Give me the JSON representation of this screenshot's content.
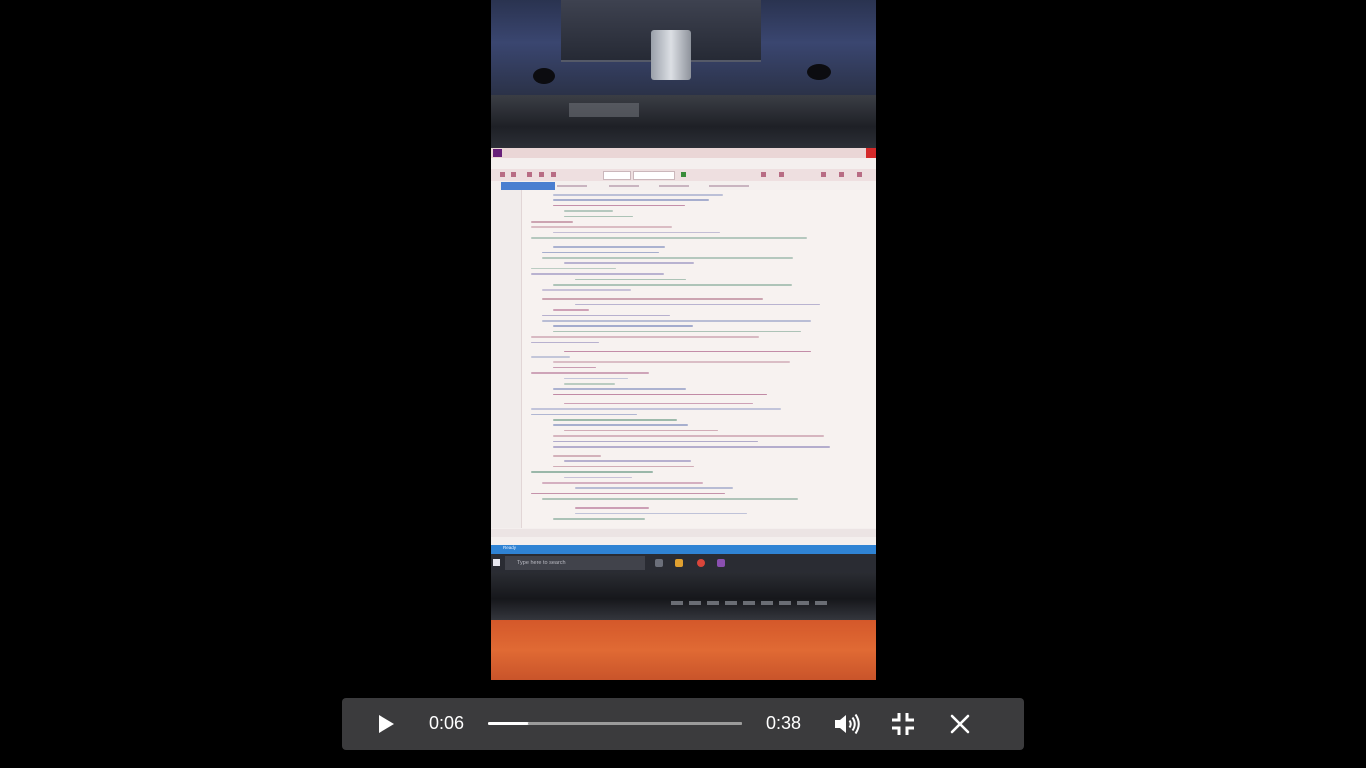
{
  "player": {
    "current_time": "0:06",
    "total_time": "0:38",
    "progress_fraction": 0.158,
    "state": "paused",
    "icons": {
      "play": "play-icon",
      "volume": "volume-icon",
      "fullscreen": "exit-fullscreen-icon",
      "close": "close-icon"
    },
    "colors": {
      "bar_background": "#3b3b3d",
      "accent": "#ffffff"
    }
  },
  "video_content": {
    "taskbar_search_placeholder": "Type here to search",
    "ide_status_ready": "Ready"
  }
}
